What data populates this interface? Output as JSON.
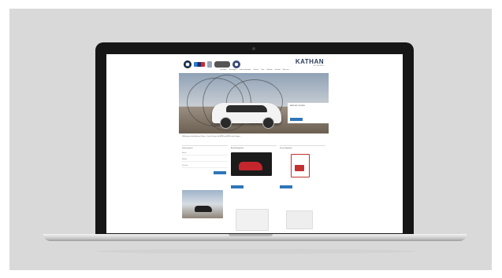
{
  "site": {
    "brand": {
      "logos": [
        "bmw-logo-icon",
        "m-logo-icon",
        "i-logo-icon",
        "mini-logo-icon",
        "bmw-m-logo-icon"
      ],
      "wordmark": "KATHAN",
      "tagline": "AUTOMOBILE"
    },
    "nav": [
      "Startseite",
      "Neuwagen",
      "Gebrauchtwagen",
      "Service",
      "Teile",
      "Zubehör",
      "Kontakt",
      "Über uns"
    ],
    "hero": {
      "headline": "BMW 3ER TOURING",
      "cta": "Mehr erfahren"
    },
    "intro": "Willkommen bei Autohaus Kathan – Ihrem Partner für BMW und MINI in der Region.",
    "columns": [
      {
        "title": "Fahrzeugsuche",
        "rows": [
          "Marke",
          "Modell",
          "Preis bis"
        ],
        "cta": "Suchen"
      },
      {
        "title": "Aktuelle Angebote",
        "cta": "Details"
      },
      {
        "title": "Service Angebote",
        "cta": "Details"
      }
    ]
  },
  "colors": {
    "accent": "#2f76b9",
    "backdrop": "#d9d9d9",
    "bezel": "#161616"
  }
}
